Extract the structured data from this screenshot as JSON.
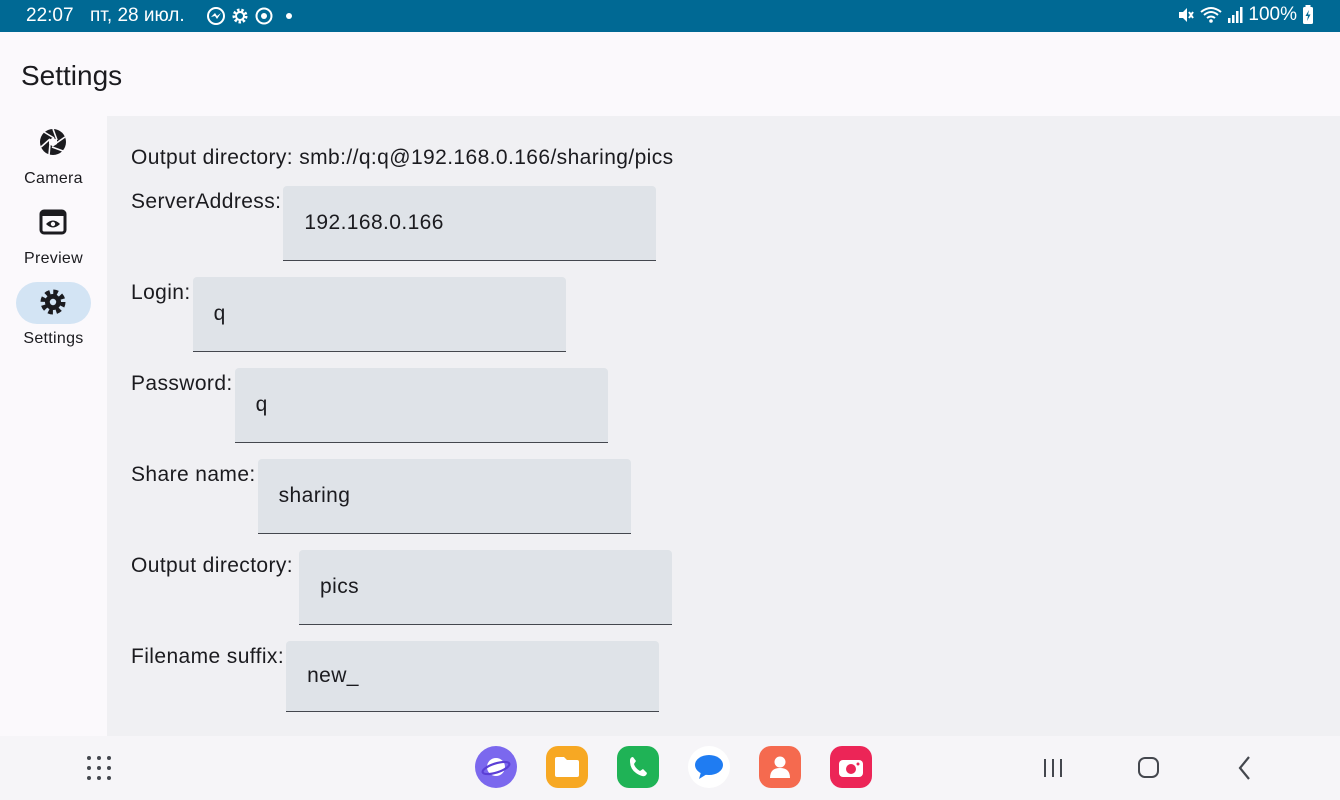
{
  "status_bar": {
    "time": "22:07",
    "date": "пт, 28 июл.",
    "battery": "100%",
    "notification_icons": [
      "messenger-icon",
      "settings-gear-icon",
      "sync-icon"
    ],
    "system_icons": [
      "mute-icon",
      "wifi-icon",
      "signal-icon",
      "battery-charging-icon"
    ],
    "background_color": "#006994"
  },
  "app_bar": {
    "title": "Settings"
  },
  "nav_rail": {
    "items": [
      {
        "label": "Camera",
        "icon": "camera-shutter-icon",
        "active": false
      },
      {
        "label": "Preview",
        "icon": "preview-eye-icon",
        "active": false
      },
      {
        "label": "Settings",
        "icon": "gear-icon",
        "active": true
      }
    ],
    "active_indicator_color": "#d3e4f4"
  },
  "settings": {
    "summary": "Output directory: smb://q:q@192.168.0.166/sharing/pics",
    "fields": [
      {
        "label": "ServerAddress:",
        "value": "192.168.0.166"
      },
      {
        "label": "Login:",
        "value": "q"
      },
      {
        "label": "Password:",
        "value": "q"
      },
      {
        "label": "Share name:",
        "value": "sharing"
      },
      {
        "label": "Output directory:",
        "value": "pics"
      },
      {
        "label": "Filename suffix:",
        "value": "new_"
      }
    ],
    "panel_color": "#f0f0f3",
    "field_color": "#dfe3e8"
  },
  "bottom_bar": {
    "apps": [
      {
        "name": "internet-browser",
        "icon": "planet-icon",
        "color": "#7b68ee"
      },
      {
        "name": "my-files",
        "icon": "folder-icon",
        "color": "#f7a823"
      },
      {
        "name": "phone",
        "icon": "phone-icon",
        "color": "#1fb356"
      },
      {
        "name": "messages",
        "icon": "chat-bubble-icon",
        "color": "#1f7cf2"
      },
      {
        "name": "contacts",
        "icon": "person-icon",
        "color": "#f56a4f"
      },
      {
        "name": "camera",
        "icon": "camera-icon",
        "color": "#ec2557"
      }
    ],
    "nav_buttons": [
      "recents-button",
      "home-button",
      "back-button"
    ]
  }
}
